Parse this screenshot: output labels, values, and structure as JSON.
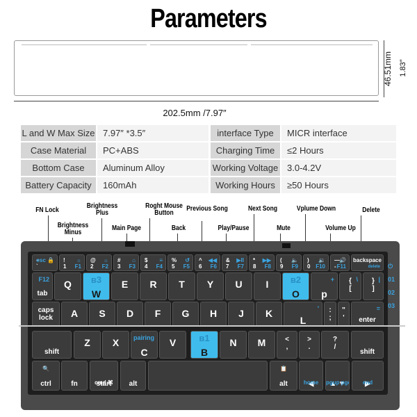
{
  "title": "Parameters",
  "dimensions": {
    "length": "202.5mm /7.97″",
    "height_mm": "46.51mm",
    "height_in": "1.83″"
  },
  "specs": [
    {
      "label": "L and W Max Size",
      "value": "7.97″  *3.5″",
      "label2": "interface Type",
      "value2": "MICR interface"
    },
    {
      "label": "Case Material",
      "value": "PC+ABS",
      "label2": "Charging Time",
      "value2": "≤2 Hours"
    },
    {
      "label": "Bottom Case",
      "value": "Aluminum Alloy",
      "label2": "Working Voltage",
      "value2": "3.0-4.2V"
    },
    {
      "label": "Battery Capacity",
      "value": "160mAh",
      "label2": "Working Hours",
      "value2": "≥50 Hours"
    }
  ],
  "annotations": [
    "FN Lock",
    "Brightness Minus",
    "Brightness Plus",
    "Main Page",
    "Roght Mouse Button",
    "Back",
    "Previous Song",
    "Play/Pause",
    "Next Song",
    "Mute",
    "Vplume Down",
    "Volume Up",
    "Delete"
  ],
  "keyboard": {
    "rows": [
      [
        {
          "main": "~\n`",
          "fn": "esc 🔒"
        },
        {
          "main": "!\n1",
          "fn": "☼\nF1"
        },
        {
          "main": "@\n2",
          "fn": "☼\nF2"
        },
        {
          "main": "#\n3",
          "fn": "⌂\nF3"
        },
        {
          "main": "$\n4",
          "fn": "≡\nF4"
        },
        {
          "main": "%\n5",
          "fn": "↺\nF5"
        },
        {
          "main": "^\n6",
          "fn": "◀◀\nF6"
        },
        {
          "main": "&\n7",
          "fn": "▶II\nF7"
        },
        {
          "main": "*\n8",
          "fn": "▶▶\nF8"
        },
        {
          "main": "(\n9",
          "fn": "🔈\nF9"
        },
        {
          "main": ")\n0",
          "fn": "🔉\nF10"
        },
        {
          "main": "—\n-",
          "fn": "🔊\nF11"
        },
        {
          "main": "backspace",
          "fn": "delete"
        }
      ],
      [
        {
          "main": "tab",
          "fn": "F12"
        },
        {
          "main": "Q"
        },
        {
          "main": "W",
          "fn": "ʙ3",
          "blue": true
        },
        {
          "main": "E"
        },
        {
          "main": "R"
        },
        {
          "main": "T"
        },
        {
          "main": "Y"
        },
        {
          "main": "U"
        },
        {
          "main": "I"
        },
        {
          "main": "O",
          "fn": "ʙ2",
          "blue": true
        },
        {
          "main": "p",
          "fn": "+"
        },
        {
          "main": "{\n[",
          "fn": "\\"
        },
        {
          "main": "}\n]",
          "fn": "|"
        }
      ],
      [
        {
          "main": "caps\nlock"
        },
        {
          "main": "A"
        },
        {
          "main": "S"
        },
        {
          "main": "D"
        },
        {
          "main": "F"
        },
        {
          "main": "G"
        },
        {
          "main": "H"
        },
        {
          "main": "J"
        },
        {
          "main": "K"
        },
        {
          "main": "L",
          "fn": "'"
        },
        {
          "main": ":\n;"
        },
        {
          "main": "\"\n'"
        },
        {
          "main": "enter",
          "fn": "="
        }
      ],
      [
        {
          "main": "shift"
        },
        {
          "main": "Z"
        },
        {
          "main": "X"
        },
        {
          "main": "C",
          "fn": "pairing"
        },
        {
          "main": "V"
        },
        {
          "main": "B",
          "fn": "ʙ1",
          "blue": true
        },
        {
          "main": "N"
        },
        {
          "main": "M"
        },
        {
          "main": "<\n,"
        },
        {
          "main": ">\n."
        },
        {
          "main": "?\n/"
        },
        {
          "main": "shift"
        }
      ],
      [
        {
          "main": "ctrl",
          "fn": "🔍"
        },
        {
          "main": "fn"
        },
        {
          "main": "start",
          "fn": "cmd ⌘"
        },
        {
          "main": "alt"
        },
        {
          "main": ""
        },
        {
          "main": "alt",
          "fn": "📋"
        },
        {
          "main": "◀",
          "fn": "home"
        },
        {
          "main": "▲ ▼",
          "fn": "pgup pgdn"
        },
        {
          "main": "▶",
          "fn": "end"
        }
      ]
    ],
    "indicators": [
      "⏻",
      "01",
      "02",
      "03"
    ],
    "colors": {
      "body": "#4a4a4a",
      "key": "#3b3b3b",
      "highlight": "#3fbcec",
      "fn_text": "#3aa3e0"
    }
  }
}
